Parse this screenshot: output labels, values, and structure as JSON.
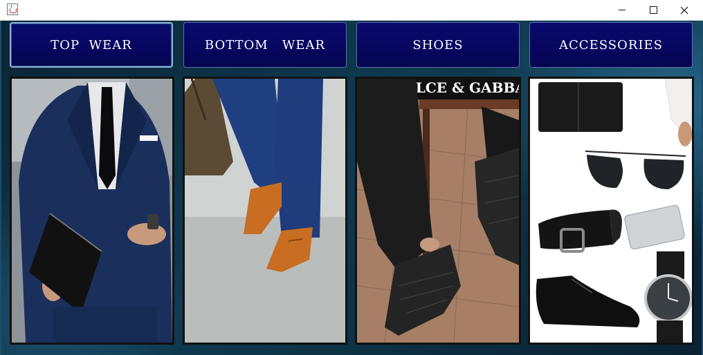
{
  "window": {
    "icon": "java-cup-icon",
    "controls": [
      "minimize-icon",
      "maximize-icon",
      "close-icon"
    ]
  },
  "categories": [
    {
      "label": "TOP  WEAR",
      "image": "navy suit with black clutch"
    },
    {
      "label": "BOTTOM   WEAR",
      "image": "navy trousers with brown brogues"
    },
    {
      "label": "SHOES",
      "image": "black woven leather shoes"
    },
    {
      "label": "ACCESSORIES",
      "image": "wallet, sunglasses, belt, card case, shoes, watch"
    }
  ],
  "brand_text": "DOLCE & GABBA",
  "colors": {
    "button_bg": "#07075f",
    "button_text": "#ffffff",
    "background": "#0d2a3a"
  }
}
